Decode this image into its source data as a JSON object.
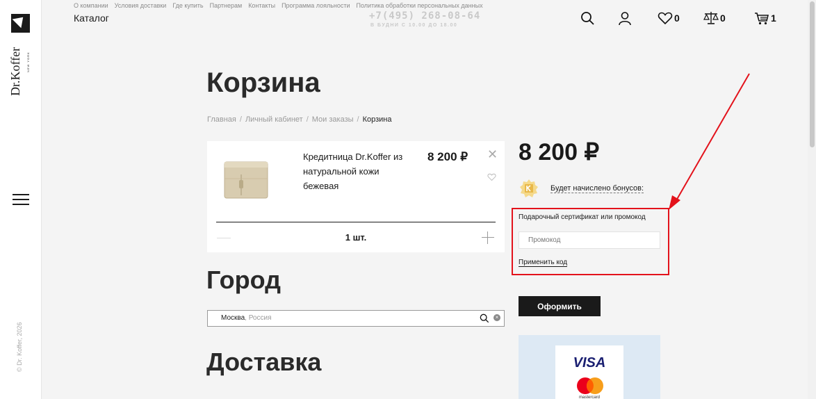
{
  "sidebar": {
    "logo_text": "Dr.Koffer",
    "logo_subtext": "NEW YORK",
    "copyright": "© Dr. Koffer, 2026"
  },
  "header": {
    "top_links": [
      "О компании",
      "Условия доставки",
      "Где купить",
      "Партнерам",
      "Контакты",
      "Программа лояльности",
      "Политика обработки персональных данных"
    ],
    "catalog_label": "Каталог",
    "phone": "+7(495) 268-08-64",
    "hours": "В БУДНИ С 10.00 ДО 18.00",
    "favorites_count": "0",
    "compare_count": "0",
    "cart_count": "1"
  },
  "page": {
    "title": "Корзина",
    "breadcrumb": [
      "Главная",
      "Личный кабинет",
      "Мои заказы",
      "Корзина"
    ]
  },
  "cart_item": {
    "title": "Кредитница Dr.Koffer из натуральной кожи бежевая",
    "price": "8 200 ₽",
    "quantity": "1 шт."
  },
  "city": {
    "title": "Город",
    "value": "Москва",
    "country": ", Россия"
  },
  "delivery": {
    "title": "Доставка"
  },
  "summary": {
    "total": "8 200 ₽",
    "bonus_label": "Будет начислено бонусов:",
    "promo_label": "Подарочный сертификат или промокод",
    "promo_placeholder": "Промокод",
    "apply_label": "Применить код",
    "checkout_label": "Оформить"
  },
  "payment": {
    "visa": "VISA",
    "mastercard": "mastercard"
  },
  "colors": {
    "accent": "#e3121b",
    "dark": "#1a1a1a",
    "payment_panel": "#dde9f4"
  }
}
